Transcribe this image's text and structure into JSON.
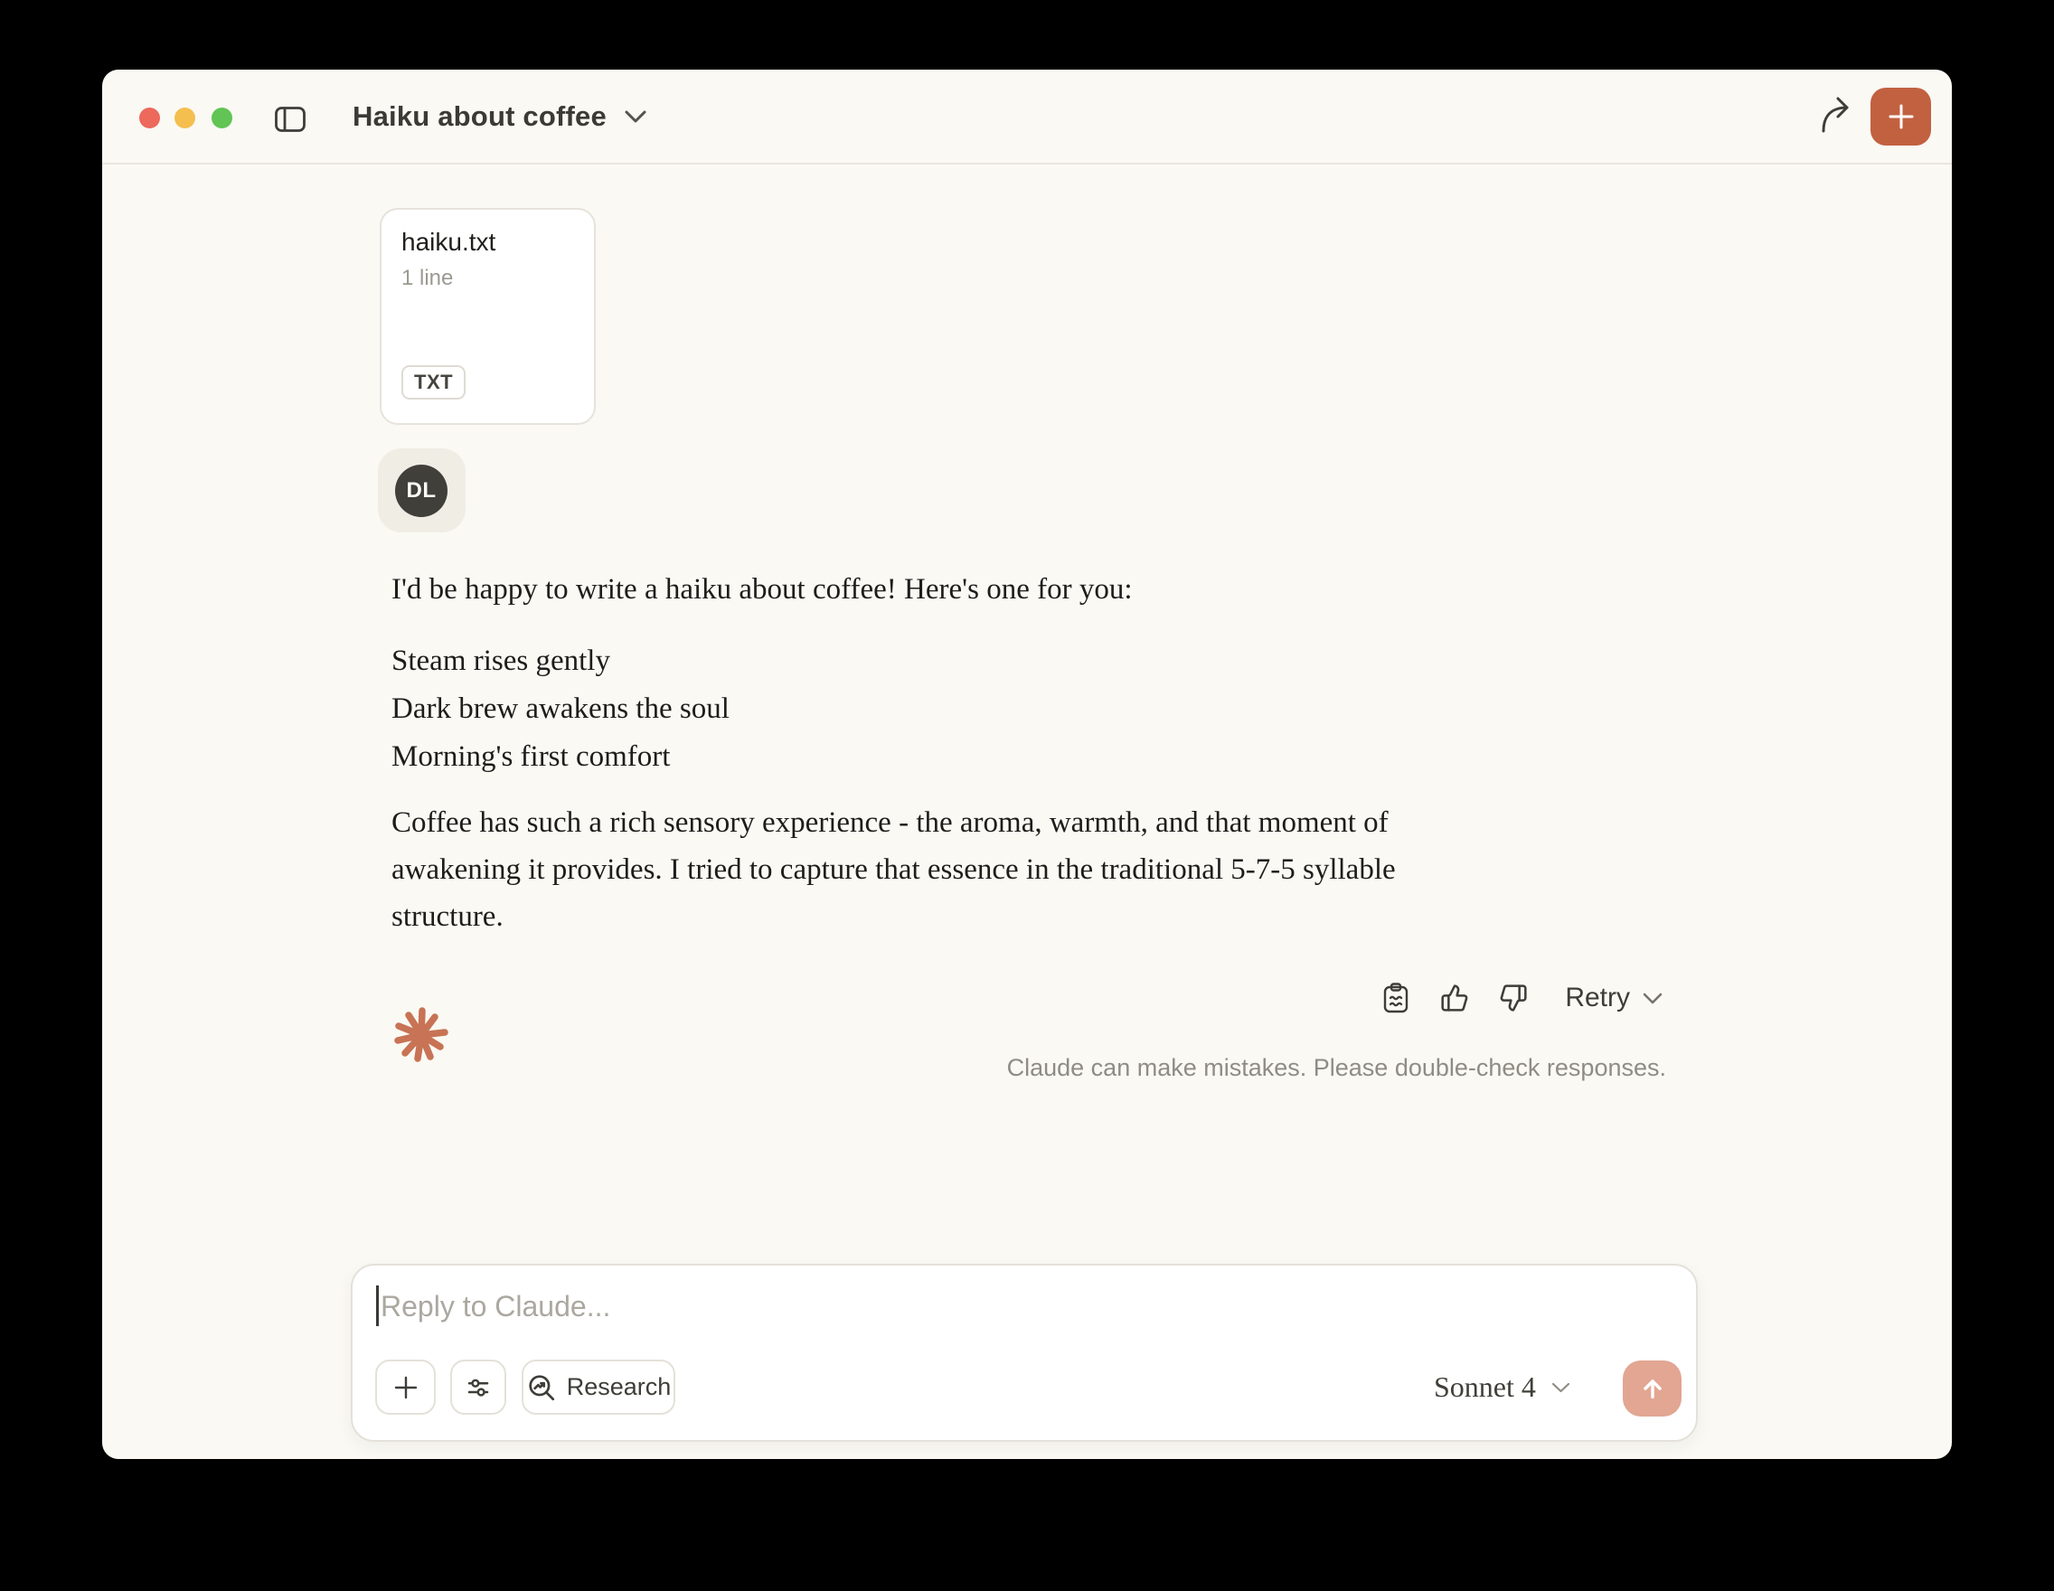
{
  "titlebar": {
    "title": "Haiku about coffee"
  },
  "attachment": {
    "filename": "haiku.txt",
    "meta": "1 line",
    "badge": "TXT"
  },
  "user": {
    "initials": "DL"
  },
  "message": {
    "intro": "I'd be happy to write a haiku about coffee! Here's one for you:",
    "haiku_lines": [
      "Steam rises gently",
      "Dark brew awakens the soul",
      "Morning's first comfort"
    ],
    "outro_lines": [
      "Coffee has such a rich sensory experience - the aroma, warmth, and that moment of",
      "awakening it provides. I tried to capture that essence in the traditional 5-7-5 syllable",
      "structure."
    ]
  },
  "actions": {
    "retry_label": "Retry"
  },
  "footer": {
    "disclaimer": "Claude can make mistakes. Please double-check responses."
  },
  "composer": {
    "placeholder": "Reply to Claude...",
    "research_label": "Research",
    "model_label": "Sonnet 4"
  },
  "colors": {
    "accent": "#C26140",
    "send_button": "#E2A693",
    "logo": "#C87355",
    "traffic_red": "#EC695C",
    "traffic_yellow": "#F5BF4F",
    "traffic_green": "#61C454"
  }
}
